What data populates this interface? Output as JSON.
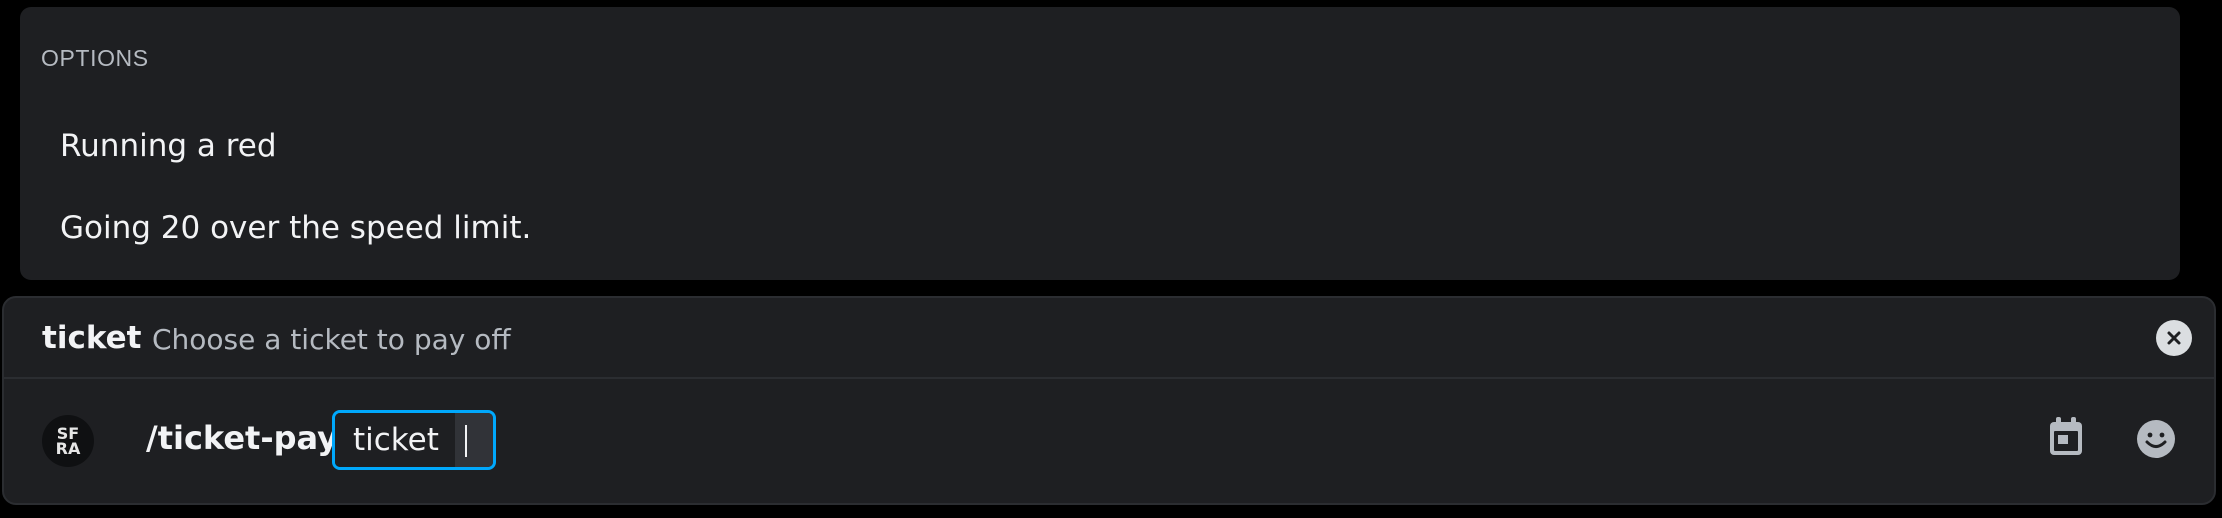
{
  "options_panel": {
    "header": "OPTIONS",
    "items": [
      {
        "label": "Running a red"
      },
      {
        "label": "Going 20 over the speed limit."
      }
    ]
  },
  "composer": {
    "param_bar": {
      "name": "ticket",
      "description": "Choose a ticket to pay off",
      "close_icon": "close-circle-icon"
    },
    "input": {
      "app_avatar_text": "SF\nRA",
      "command": "/ticket-pay",
      "option_label": "ticket",
      "option_value": ""
    },
    "buttons": {
      "schedule_icon": "calendar-icon",
      "emoji_icon": "emoji-smile-icon"
    }
  },
  "colors": {
    "panel_bg": "#1e1f22",
    "accent_focus": "#00a8fc",
    "text_primary": "#f2f3f5",
    "text_muted": "#b5bac1"
  }
}
